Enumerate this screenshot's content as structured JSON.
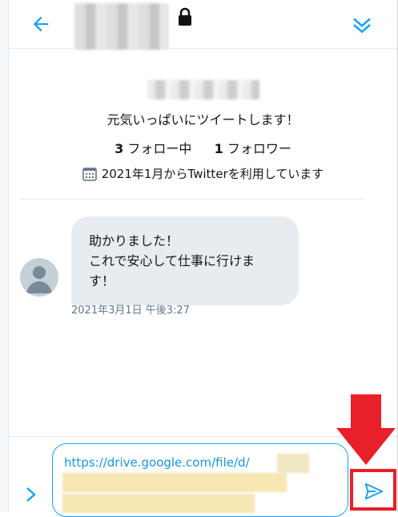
{
  "profile": {
    "bio": "元気いっぱいにツイートします！",
    "following_count": "3",
    "following_label": "フォロー中",
    "followers_count": "1",
    "followers_label": "フォロワー",
    "joined": "2021年1月からTwitterを利用しています"
  },
  "messages": [
    {
      "lines": [
        "助かりました！",
        "これで安心して仕事に行けま",
        "す！"
      ],
      "timestamp": "2021年3月1日 午後3:27"
    }
  ],
  "composer": {
    "text": "https://drive.google.com/file/d/"
  },
  "icons": {
    "back": "arrow-left-icon",
    "lock": "lock-icon",
    "collapse": "double-chevron-down-icon",
    "calendar": "calendar-icon",
    "expand": "chevron-right-icon",
    "emoji": "smiley-icon",
    "send": "paper-plane-icon",
    "annotation": "red-down-arrow"
  },
  "colors": {
    "accent": "#1da1f2",
    "bubble": "#e6ecf0",
    "highlight": "#e8202a"
  }
}
